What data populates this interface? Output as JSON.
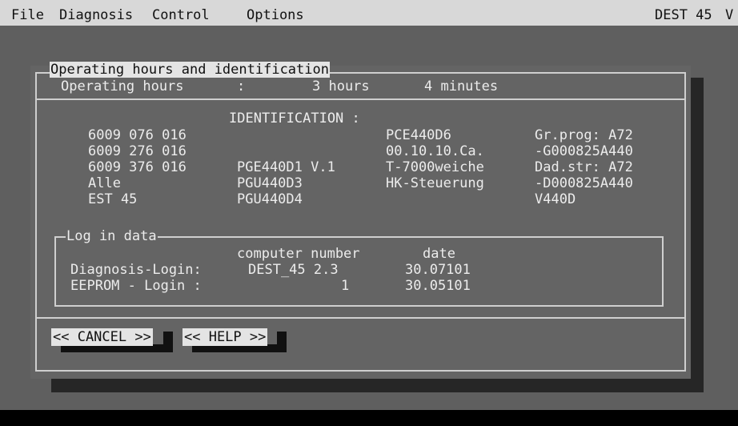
{
  "menu": {
    "file": "File",
    "diagnosis": "Diagnosis",
    "control": "Control",
    "options": "Options",
    "station": "DEST 45",
    "edge": "V"
  },
  "dialog": {
    "title": "Operating hours and identification",
    "op_hours_label": "Operating hours",
    "op_hours_colon": ":",
    "op_hours_hours": "3 hours",
    "op_hours_minutes": "4 minutes",
    "ident_header": "IDENTIFICATION :",
    "ident_col1": [
      "6009 076 016",
      "6009 276 016",
      "6009 376 016",
      "Alle",
      "EST 45"
    ],
    "ident_col2": [
      "",
      "",
      "PGE440D1 V.1",
      "PGU440D3",
      "PGU440D4"
    ],
    "ident_col3": [
      "PCE440D6",
      "00.10.10.Ca.",
      "T-7000weiche",
      "HK-Steuerung",
      ""
    ],
    "ident_col4": [
      "Gr.prog: A72",
      "-G000825A440",
      "Dad.str: A72",
      "-D000825A440",
      "V440D"
    ],
    "login": {
      "title": "Log in data",
      "col_computer": "computer number",
      "col_date": "date",
      "rows": [
        {
          "label": "Diagnosis-Login:",
          "computer": "DEST_45 2.3",
          "date": "30.07101"
        },
        {
          "label": "EEPROM - Login :",
          "computer": "1",
          "date": "30.05101"
        }
      ]
    },
    "buttons": {
      "cancel": "<< CANCEL >>",
      "help": "<< HELP >>"
    }
  }
}
